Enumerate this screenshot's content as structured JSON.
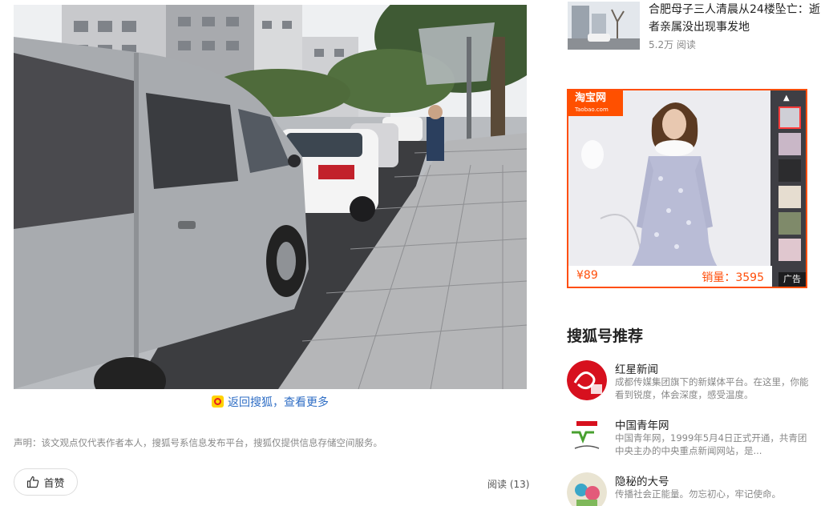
{
  "article": {
    "back_link": "返回搜狐，查看更多",
    "disclaimer": "声明：该文观点仅代表作者本人，搜狐号系信息发布平台，搜狐仅提供信息存储空间服务。",
    "like_label": "首赞",
    "read_count": "阅读 (13)"
  },
  "sidebar": {
    "news": {
      "title": "合肥母子三人清晨从24楼坠亡：逝者亲属没出现事发地",
      "reads": "5.2万 阅读"
    },
    "ad": {
      "brand": "淘宝网",
      "brand_sub": "Taobao.com",
      "price": "¥89",
      "sales": "销量：3595",
      "tag": "广告"
    },
    "recommend_title": "搜狐号推荐",
    "accounts": [
      {
        "name": "红星新闻",
        "desc": "成都传媒集团旗下的新媒体平台。在这里，你能看到锐度，体会深度，感受温度。"
      },
      {
        "name": "中国青年网",
        "desc": "中国青年网，1999年5月4日正式开通，共青团中央主办的中央重点新闻网站，是..."
      },
      {
        "name": "隐秘的大号",
        "desc": "传播社会正能量。勿忘初心，牢记使命。"
      }
    ]
  },
  "colors": {
    "link": "#2f6ec5",
    "ad_accent": "#ff4e0a",
    "hongxing_red": "#d7101e"
  }
}
